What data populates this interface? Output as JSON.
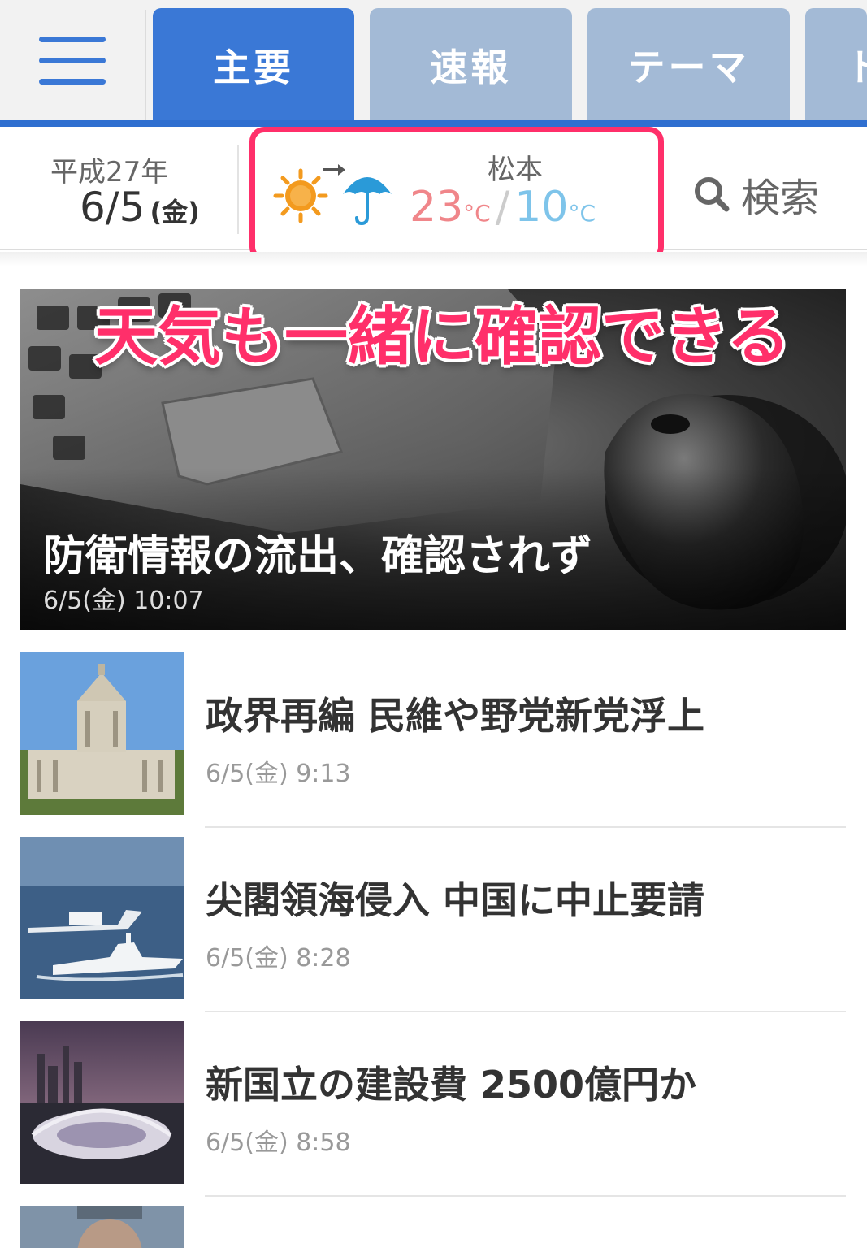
{
  "tabs": [
    {
      "label": "主要",
      "active": true
    },
    {
      "label": "速報",
      "active": false
    },
    {
      "label": "テーマ",
      "active": false
    },
    {
      "label": "ト",
      "active": false
    }
  ],
  "info": {
    "era": "平成27年",
    "date": "6/5",
    "weekday": "(金)",
    "weather": {
      "city": "松本",
      "high": "23",
      "low": "10",
      "unit": "°C",
      "icons": [
        "sun-icon",
        "arrow-icon",
        "umbrella-icon"
      ]
    },
    "search_label": "検索"
  },
  "callout": "天気も一緒に確認できる",
  "hero": {
    "title": "防衛情報の流出、確認されず",
    "time": "6/5(金) 10:07"
  },
  "news": [
    {
      "title": "政界再編 民維や野党新党浮上",
      "time": "6/5(金) 9:13"
    },
    {
      "title": "尖閣領海侵入 中国に中止要請",
      "time": "6/5(金) 8:28"
    },
    {
      "title": "新国立の建設費 2500億円か",
      "time": "6/5(金) 8:58"
    }
  ],
  "colors": {
    "accent": "#3a78d6",
    "tab_inactive": "#a3bad6",
    "highlight": "#ff2f6a",
    "temp_high": "#f0868a",
    "temp_low": "#7ec4ea"
  }
}
